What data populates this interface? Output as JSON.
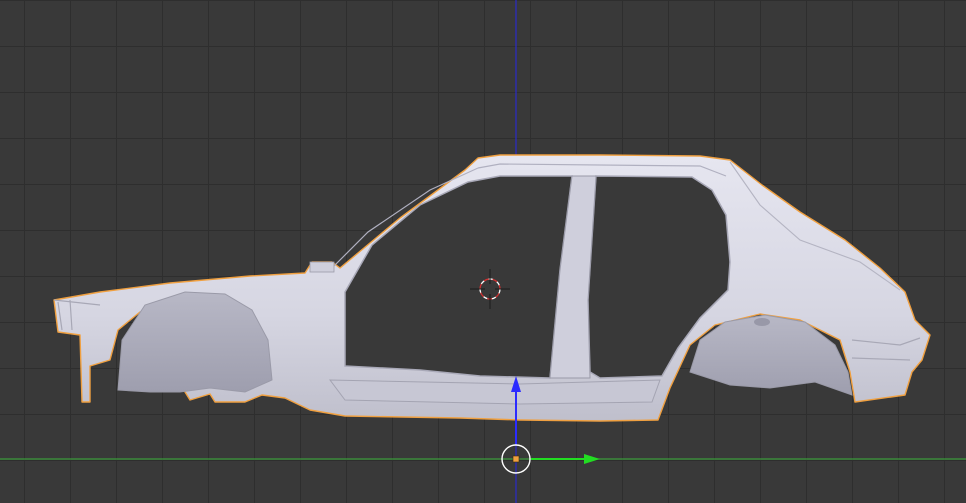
{
  "viewport": {
    "background_color": "#393939",
    "grid_color": "#2e2e2e",
    "x_axis_color": "#3c9c3c",
    "z_axis_color": "#2b2bc8",
    "mesh_fill": "#d9d9e6",
    "mesh_outline": "#f0a040"
  },
  "objects": [
    {
      "name": "car-body-shell",
      "selected": true
    }
  ],
  "icons": {
    "cursor": "3d-cursor-icon",
    "manipulator": "transform-manipulator-icon",
    "origin": "object-origin-icon"
  }
}
